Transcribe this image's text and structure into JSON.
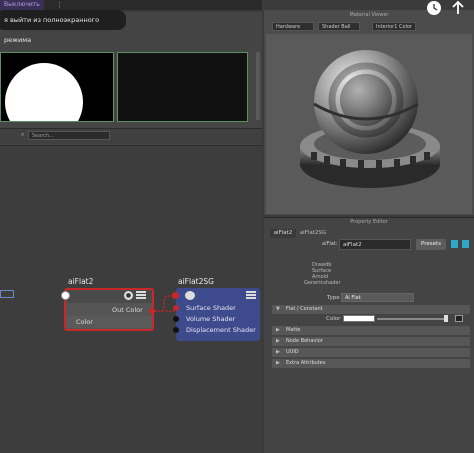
{
  "top": {
    "app_tab": "Выключить",
    "dots": "⋮",
    "toast": "я выйти из полноэкранного режима"
  },
  "hypershade": {
    "search_placeholder": "Search..."
  },
  "nodes": {
    "shader": {
      "title": "aiFlat2",
      "out_port": "Out Color",
      "in_port": "Color"
    },
    "shading_group": {
      "title": "aiFlat2SG",
      "rows": [
        "Surface Shader",
        "Volume Shader",
        "Displacement Shader"
      ]
    }
  },
  "material_viewer": {
    "title": "Material Viewer",
    "renderer": "Hardware",
    "shape": "Shader Ball",
    "lighting": "Interior1 Color"
  },
  "property_editor": {
    "title": "Property Editor",
    "tabs": [
      "aiFlat2",
      "aiFlat2SG"
    ],
    "name_label": "aiFlat:",
    "name_value": "aiFlat2",
    "presets": "Presets",
    "classifications": [
      "Drawdb",
      "Surface",
      "Arnold",
      "Genericshader"
    ],
    "type_label": "Type",
    "type_value": "Ai Flat",
    "sections": {
      "flat_constant": "Flat / Constant",
      "color_label": "Color",
      "matte": "Matte",
      "node_behavior": "Node Behavior",
      "uuid": "UUID",
      "extra_attributes": "Extra Attributes"
    }
  },
  "colors": {
    "selected_node_border": "#c8282a",
    "shading_group_fill": "#3d4a8c",
    "flat_color": "#ffffff"
  }
}
